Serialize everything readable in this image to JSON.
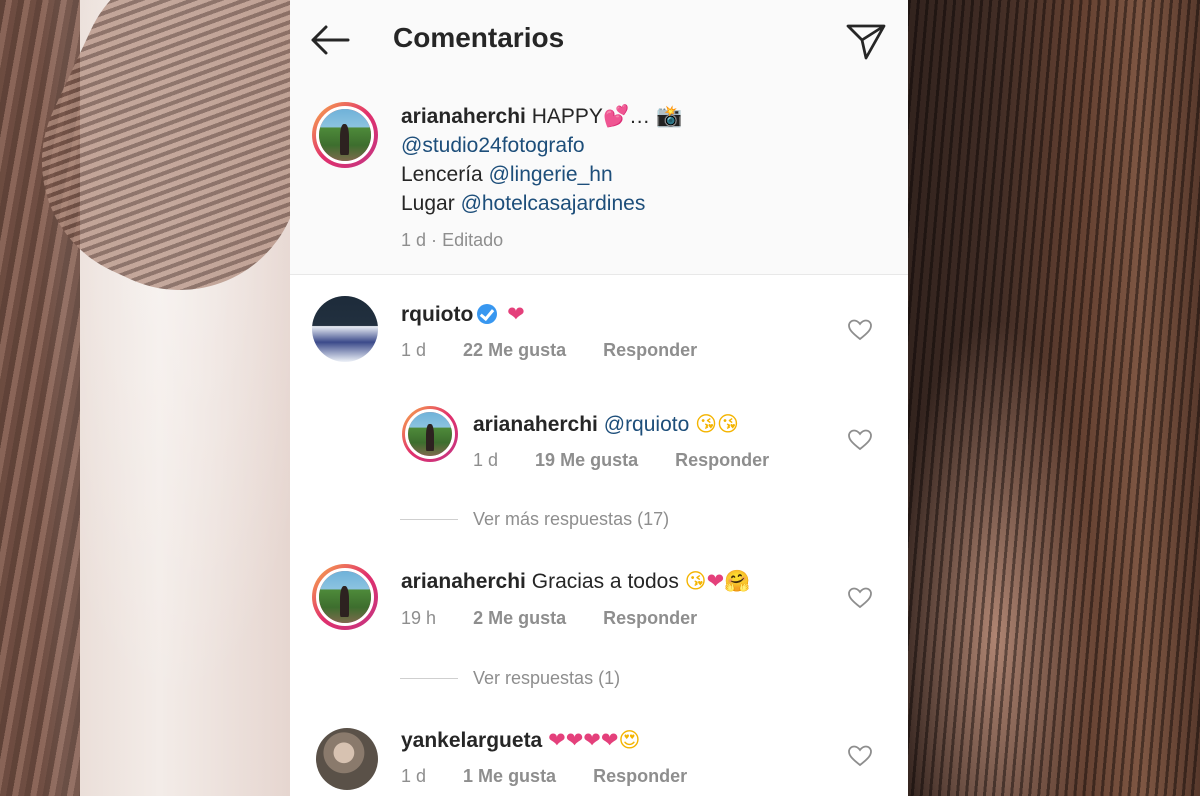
{
  "header": {
    "title": "Comentarios",
    "back_icon": "back-arrow-icon",
    "send_icon": "paper-plane-icon"
  },
  "post": {
    "username": "arianaherchi",
    "caption_text": "HAPPY",
    "caption_suffix": "…",
    "line2_mention": "@studio24fotografo",
    "line3_label": "Lencería",
    "line3_mention": "@lingerie_hn",
    "line4_label": "Lugar",
    "line4_mention": "@hotelcasajardines",
    "time": "1 d",
    "separator": "·",
    "edited": "Editado"
  },
  "comments": [
    {
      "username": "rquioto",
      "verified": true,
      "text": "",
      "time": "1 d",
      "likes": "22 Me gusta",
      "reply": "Responder"
    },
    {
      "username": "arianaherchi",
      "mention": "@rquioto",
      "time": "1 d",
      "likes": "19 Me gusta",
      "reply": "Responder",
      "is_reply": true
    },
    {
      "more_replies": "Ver más respuestas (17)"
    },
    {
      "username": "arianaherchi",
      "text": "Gracias a todos",
      "time": "19 h",
      "likes": "2 Me gusta",
      "reply": "Responder"
    },
    {
      "more_replies": "Ver respuestas (1)"
    },
    {
      "username": "yankelargueta",
      "time": "1 d",
      "likes": "1 Me gusta",
      "reply": "Responder"
    }
  ],
  "colors": {
    "mention": "#1d4e7a",
    "meta": "#8e8e8e",
    "verified": "#3897f0",
    "heart_emoji": "#e4407b"
  }
}
